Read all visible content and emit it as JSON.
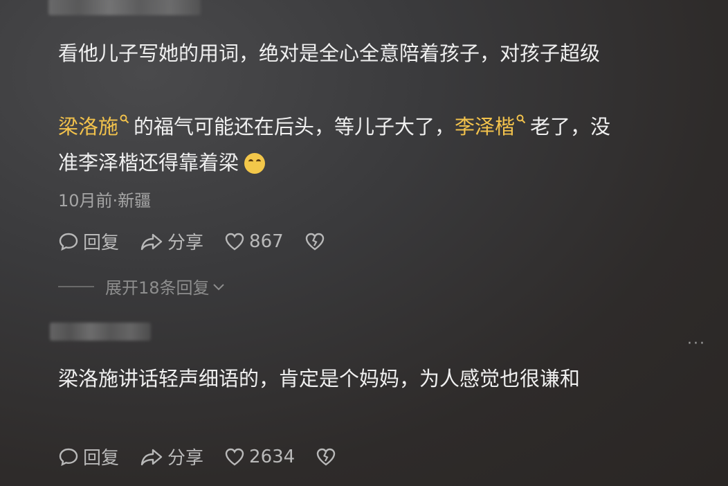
{
  "comment1": {
    "line1": "看他儿子写她的用词，绝对是全心全意陪着孩子，对孩子超级",
    "line2_link1": "梁洛施",
    "line2_mid": "的福气可能还在后头，等儿子大了，",
    "line2_link2": "李泽楷",
    "line2_end": "老了，没",
    "line3": "准李泽楷还得靠着梁",
    "emoji": "sweat-smile-emoji",
    "meta": "10月前·新疆",
    "reply_label": "回复",
    "share_label": "分享",
    "like_count": "867",
    "expand_label": "展开18条回复"
  },
  "comment2": {
    "text": "梁洛施讲话轻声细语的，肯定是个妈妈，为人感觉也很谦和",
    "reply_label": "回复",
    "share_label": "分享",
    "like_count": "2634",
    "more": "···"
  },
  "colors": {
    "highlight": "#f2c24c",
    "meta": "#a6a6a6",
    "text": "#f0f0f0"
  }
}
